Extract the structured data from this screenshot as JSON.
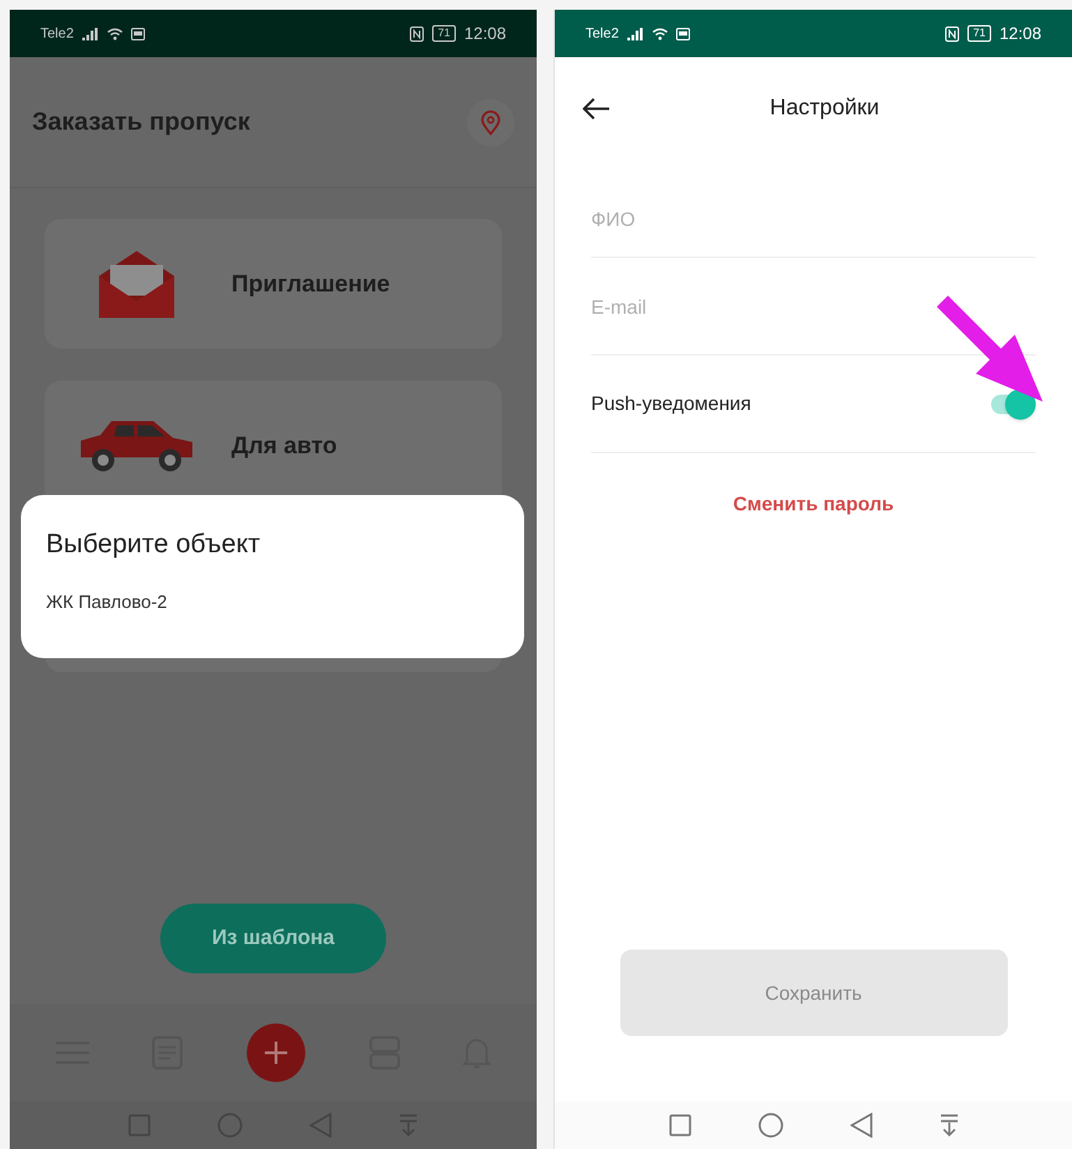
{
  "left_screen": {
    "status_bar": {
      "carrier": "Tele2",
      "battery": "71",
      "time": "12:08"
    },
    "title": "Заказать пропуск",
    "cards": [
      {
        "label": "Приглашение",
        "kind": "envelope"
      },
      {
        "label": "Для авто",
        "kind": "car"
      },
      {
        "kind": "blank"
      }
    ],
    "dialog": {
      "title": "Выберите объект",
      "items": [
        {
          "label": "ЖК Павлово-2"
        }
      ]
    },
    "template_button": "Из шаблона"
  },
  "right_screen": {
    "status_bar": {
      "carrier": "Tele2",
      "battery": "71",
      "time": "12:08"
    },
    "title": "Настройки",
    "fields": [
      {
        "placeholder": "ФИО"
      },
      {
        "placeholder": "E-mail"
      }
    ],
    "push": {
      "label": "Push-уведомения",
      "on": true
    },
    "change_password": "Сменить пароль",
    "save_button": {
      "label": "Сохранить",
      "disabled": true
    }
  }
}
